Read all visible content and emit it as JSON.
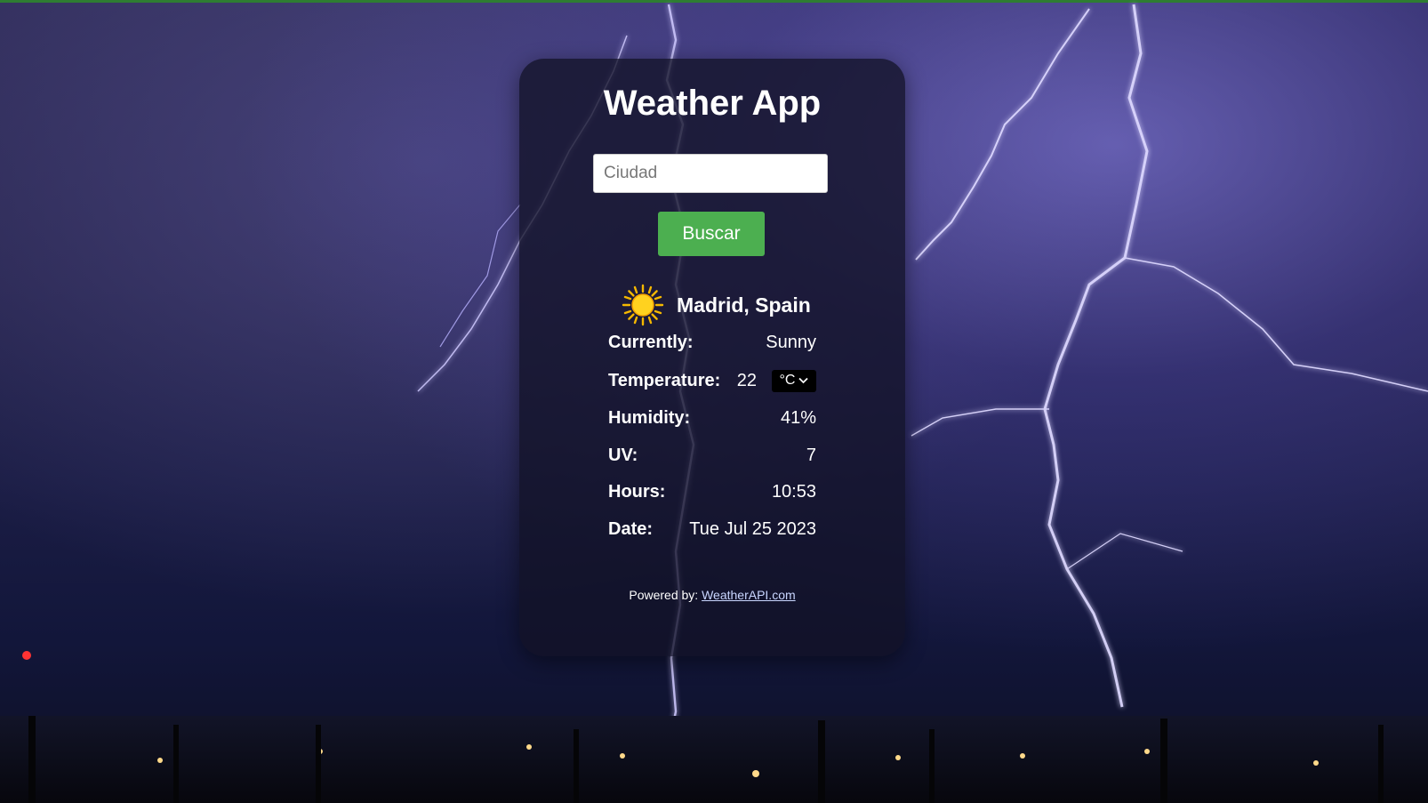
{
  "app": {
    "title": "Weather App"
  },
  "search": {
    "placeholder": "Ciudad",
    "value": "",
    "button_label": "Buscar"
  },
  "weather": {
    "icon": "sun-icon",
    "location": "Madrid, Spain",
    "rows": {
      "currently": {
        "label": "Currently:",
        "value": "Sunny"
      },
      "temperature": {
        "label": "Temperature:",
        "value": "22",
        "unit": "°C"
      },
      "humidity": {
        "label": "Humidity:",
        "value": "41%"
      },
      "uv": {
        "label": "UV:",
        "value": "7"
      },
      "hours": {
        "label": "Hours:",
        "value": "10:53"
      },
      "date": {
        "label": "Date:",
        "value": "Tue Jul 25 2023"
      }
    }
  },
  "footer": {
    "prefix": "Powered by:",
    "link_text": "WeatherAPI.com"
  },
  "colors": {
    "accent_green": "#4caf50",
    "card_bg": "#121226",
    "lightning": "#c8c4ff"
  }
}
